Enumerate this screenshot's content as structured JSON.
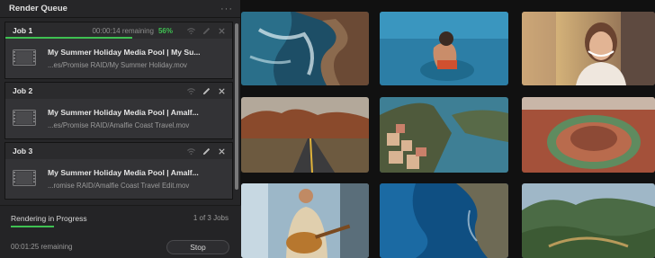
{
  "panel": {
    "title": "Render Queue"
  },
  "jobs": [
    {
      "name": "Job 1",
      "remaining": "00:00:14 remaining",
      "percent": "56%",
      "progress": 0.56,
      "clip": "My Summer Holiday Media Pool | My Su...",
      "path": "...es/Promise RAID/My Summer Holiday.mov"
    },
    {
      "name": "Job 2",
      "clip": "My Summer Holiday Media Pool | Amalf...",
      "path": "...es/Promise RAID/Amalfie Coast Travel.mov"
    },
    {
      "name": "Job 3",
      "clip": "My Summer Holiday Media Pool | Amalf...",
      "path": "...romise RAID/Amalfie Coast Travel Edit.mov"
    }
  ],
  "footer": {
    "status": "Rendering in Progress",
    "count": "1 of 3 Jobs",
    "remaining": "00:01:25 remaining",
    "stop_label": "Stop"
  },
  "icons": [
    "more-options-icon",
    "remote-render-icon",
    "edit-icon",
    "close-icon",
    "clip-icon"
  ],
  "gallery_tiles": [
    "coastal-rocks",
    "woman-swimming",
    "woman-selfie",
    "desert-road",
    "amalfi-town",
    "canyon-river",
    "man-with-guitar",
    "island-aerial",
    "mountain-valley"
  ],
  "colors": {
    "accent_green": "#3fc152",
    "panel": "#262628",
    "job_body": "#333336"
  }
}
